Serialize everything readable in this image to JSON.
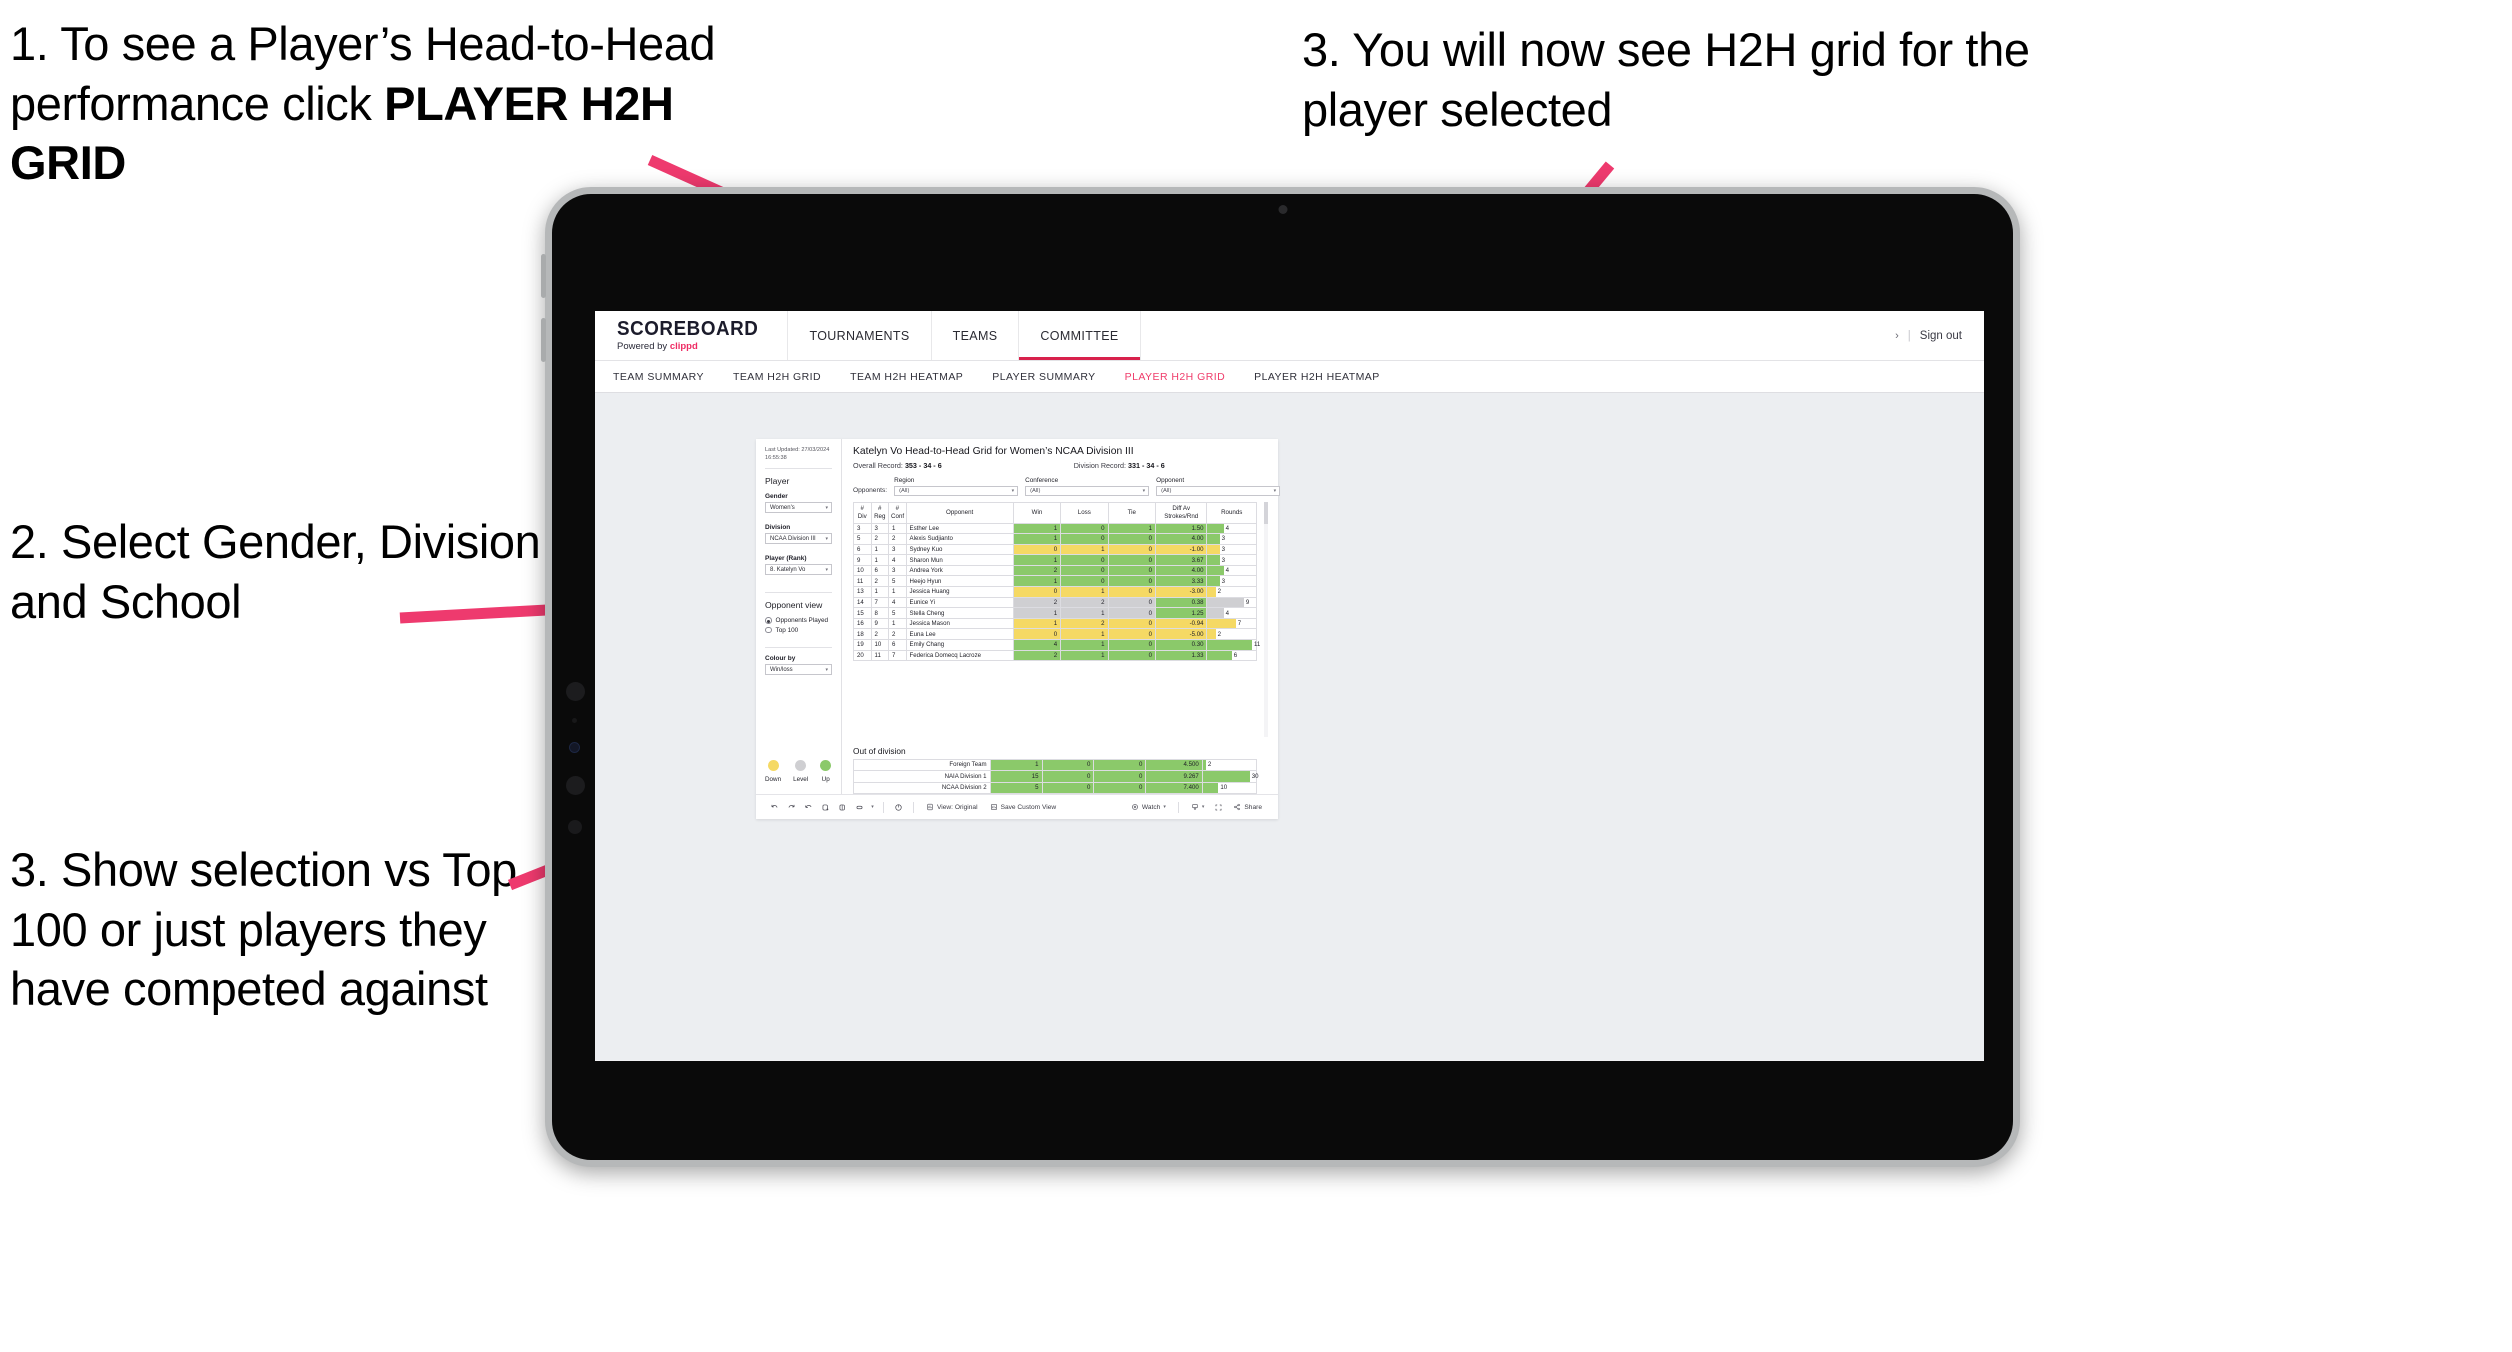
{
  "annotations": {
    "step1_a": "1. To see a Player’s Head-to-Head performance click ",
    "step1_b": "PLAYER H2H GRID",
    "step2": "2. Select Gender, Division and School",
    "step3_left": "3. Show selection vs Top 100 or just players they have competed against",
    "step3_right": "3. You will now see H2H grid for the player selected"
  },
  "colors": {
    "accent_pink": "#ee2b63",
    "tab_active": "#ef3d6b",
    "up_green": "#8bc96a",
    "down_yellow": "#f5d964",
    "level_grey": "#cfcfd2",
    "underline_red": "#d8214c"
  },
  "header": {
    "brand_name": "SCOREBOARD",
    "brand_sub_prefix": "Powered by ",
    "brand_sub_accent": "clippd",
    "nav": [
      {
        "label": "TOURNAMENTS",
        "selected": false
      },
      {
        "label": "TEAMS",
        "selected": false
      },
      {
        "label": "COMMITTEE",
        "selected": true
      }
    ],
    "chevron": "›",
    "divider": "|",
    "sign_out": "Sign out"
  },
  "subnav": {
    "items": [
      {
        "label": "TEAM SUMMARY",
        "active": false
      },
      {
        "label": "TEAM H2H GRID",
        "active": false
      },
      {
        "label": "TEAM H2H HEATMAP",
        "active": false
      },
      {
        "label": "PLAYER SUMMARY",
        "active": false
      },
      {
        "label": "PLAYER H2H GRID",
        "active": true
      },
      {
        "label": "PLAYER H2H HEATMAP",
        "active": false
      }
    ]
  },
  "sidebar": {
    "last_updated": "Last Updated: 27/03/2024 16:55:38",
    "player_heading": "Player",
    "gender_label": "Gender",
    "gender_value": "Women's",
    "division_label": "Division",
    "division_value": "NCAA Division III",
    "player_rank_label": "Player (Rank)",
    "player_rank_value": "8. Katelyn Vo",
    "opponent_view_heading": "Opponent view",
    "opponent_view_options": [
      {
        "label": "Opponents Played",
        "selected": true
      },
      {
        "label": "Top 100",
        "selected": false
      }
    ],
    "colour_by_label": "Colour by",
    "colour_by_value": "Win/loss",
    "legend": [
      {
        "label": "Down",
        "color": "#f5d964"
      },
      {
        "label": "Level",
        "color": "#cfcfd2"
      },
      {
        "label": "Up",
        "color": "#8bc96a"
      }
    ]
  },
  "viz": {
    "title": "Katelyn Vo Head-to-Head Grid for Women’s NCAA Division III",
    "overall_record_label": "Overall Record:",
    "overall_record_value": "353 -  34 - 6",
    "division_record_label": "Division Record:",
    "division_record_value": "331 -  34 - 6",
    "opponents_label": "Opponents:",
    "filters": [
      {
        "label": "Region",
        "value": "(All)"
      },
      {
        "label": "Conference",
        "value": "(All)"
      },
      {
        "label": "Opponent",
        "value": "(All)"
      }
    ],
    "out_of_division_title": "Out of division"
  },
  "chart_data": {
    "type": "table",
    "title": "Katelyn Vo Head-to-Head Grid for Women’s NCAA Division III",
    "columns": [
      "# Div",
      "# Reg",
      "# Conf",
      "Opponent",
      "Win",
      "Loss",
      "Tie",
      "Diff Av Strokes/Rnd",
      "Rounds"
    ],
    "rounds_axis_max": 12,
    "rows": [
      {
        "div": "3",
        "reg": "3",
        "conf": "1",
        "opponent": "Esther Lee",
        "win": "1",
        "loss": "0",
        "tie": "1",
        "diff": "1.50",
        "rounds": "4",
        "state": "up"
      },
      {
        "div": "5",
        "reg": "2",
        "conf": "2",
        "opponent": "Alexis Sudjianto",
        "win": "1",
        "loss": "0",
        "tie": "0",
        "diff": "4.00",
        "rounds": "3",
        "state": "up"
      },
      {
        "div": "6",
        "reg": "1",
        "conf": "3",
        "opponent": "Sydney Kuo",
        "win": "0",
        "loss": "1",
        "tie": "0",
        "diff": "-1.00",
        "rounds": "3",
        "state": "down"
      },
      {
        "div": "9",
        "reg": "1",
        "conf": "4",
        "opponent": "Sharon Mun",
        "win": "1",
        "loss": "0",
        "tie": "0",
        "diff": "3.67",
        "rounds": "3",
        "state": "up"
      },
      {
        "div": "10",
        "reg": "6",
        "conf": "3",
        "opponent": "Andrea York",
        "win": "2",
        "loss": "0",
        "tie": "0",
        "diff": "4.00",
        "rounds": "4",
        "state": "up"
      },
      {
        "div": "11",
        "reg": "2",
        "conf": "5",
        "opponent": "Heejo Hyun",
        "win": "1",
        "loss": "0",
        "tie": "0",
        "diff": "3.33",
        "rounds": "3",
        "state": "up"
      },
      {
        "div": "13",
        "reg": "1",
        "conf": "1",
        "opponent": "Jessica Huang",
        "win": "0",
        "loss": "1",
        "tie": "0",
        "diff": "-3.00",
        "rounds": "2",
        "state": "down"
      },
      {
        "div": "14",
        "reg": "7",
        "conf": "4",
        "opponent": "Eunice Yi",
        "win": "2",
        "loss": "2",
        "tie": "0",
        "diff": "0.38",
        "rounds": "9",
        "state": "level",
        "diff_state": "up"
      },
      {
        "div": "15",
        "reg": "8",
        "conf": "5",
        "opponent": "Stella Cheng",
        "win": "1",
        "loss": "1",
        "tie": "0",
        "diff": "1.25",
        "rounds": "4",
        "state": "level",
        "diff_state": "up"
      },
      {
        "div": "16",
        "reg": "9",
        "conf": "1",
        "opponent": "Jessica Mason",
        "win": "1",
        "loss": "2",
        "tie": "0",
        "diff": "-0.94",
        "rounds": "7",
        "state": "down"
      },
      {
        "div": "18",
        "reg": "2",
        "conf": "2",
        "opponent": "Euna Lee",
        "win": "0",
        "loss": "1",
        "tie": "0",
        "diff": "-5.00",
        "rounds": "2",
        "state": "down"
      },
      {
        "div": "19",
        "reg": "10",
        "conf": "6",
        "opponent": "Emily Chang",
        "win": "4",
        "loss": "1",
        "tie": "0",
        "diff": "0.30",
        "rounds": "11",
        "state": "up"
      },
      {
        "div": "20",
        "reg": "11",
        "conf": "7",
        "opponent": "Federica Domecq Lacroze",
        "win": "2",
        "loss": "1",
        "tie": "0",
        "diff": "1.33",
        "rounds": "6",
        "state": "up"
      }
    ],
    "out_of_division": {
      "rounds_axis_max": 34,
      "rows": [
        {
          "label": "Foreign Team",
          "win": "1",
          "loss": "0",
          "tie": "0",
          "diff": "4.500",
          "rounds": "2",
          "state": "up"
        },
        {
          "label": "NAIA Division 1",
          "win": "15",
          "loss": "0",
          "tie": "0",
          "diff": "9.267",
          "rounds": "30",
          "state": "up"
        },
        {
          "label": "NCAA Division 2",
          "win": "5",
          "loss": "0",
          "tie": "0",
          "diff": "7.400",
          "rounds": "10",
          "state": "up"
        }
      ]
    }
  },
  "toolbar": {
    "view_original": "View: Original",
    "save_custom_view": "Save Custom View",
    "watch": "Watch",
    "share": "Share",
    "caret": "▾"
  }
}
